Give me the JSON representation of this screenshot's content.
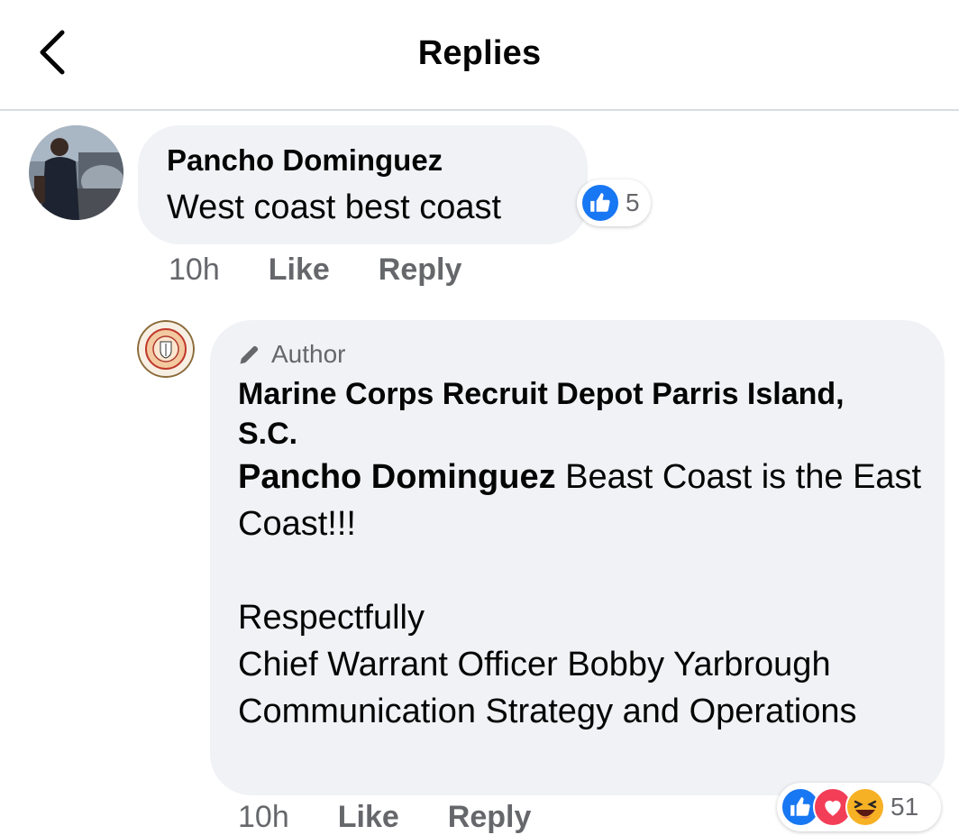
{
  "header": {
    "title": "Replies",
    "back_icon": "chevron-left-icon"
  },
  "comment": {
    "author": "Pancho Dominguez",
    "text": "West coast best coast",
    "reaction_count": "5",
    "reaction_icons": [
      "like-icon"
    ],
    "time": "10h",
    "like_label": "Like",
    "reply_label": "Reply"
  },
  "reply": {
    "badge_icon": "pencil-icon",
    "badge_label": "Author",
    "author": "Marine Corps Recruit Depot Parris Island, S.C.",
    "mention": "Pancho Dominguez",
    "text_line1": " Beast Coast is the East Coast!!!",
    "signoff": "Respectfully",
    "signature_name": "Chief Warrant Officer Bobby Yarbrough",
    "signature_title": "Communication Strategy and Operations",
    "reaction_count": "51",
    "reaction_icons": [
      "like-icon",
      "love-icon",
      "haha-icon"
    ],
    "time": "10h",
    "like_label": "Like",
    "reply_label": "Reply"
  },
  "colors": {
    "bubble": "#f0f2f5",
    "secondary_text": "#65676b",
    "like_blue": "#1877f2",
    "love_red": "#f33e58",
    "haha_yellow": "#f7b125"
  }
}
